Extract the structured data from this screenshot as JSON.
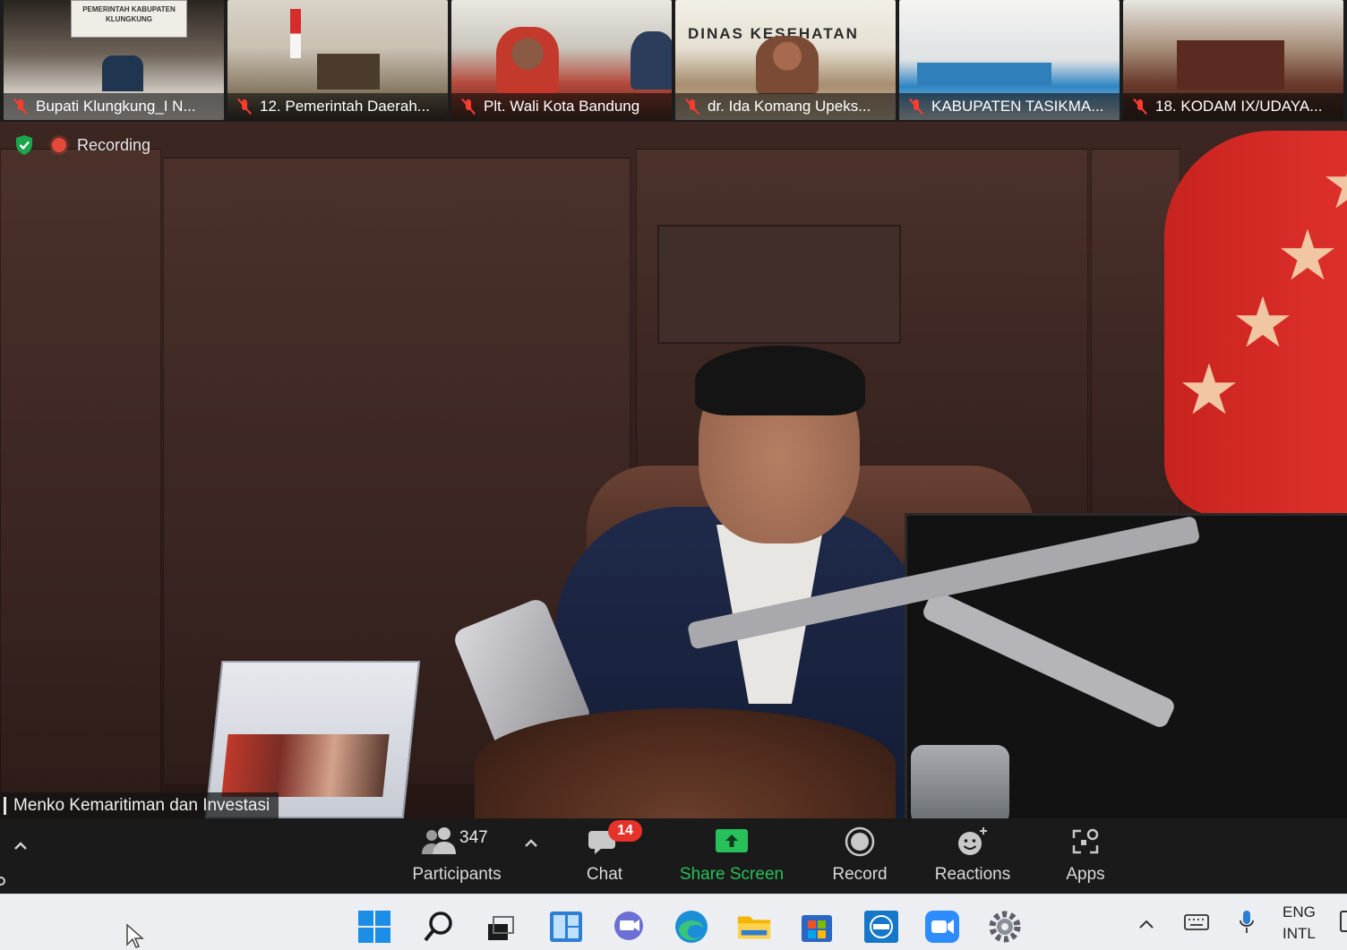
{
  "gallery": {
    "participants": [
      {
        "name": "Bupati Klungkung_I N...",
        "muted": true
      },
      {
        "name": "12. Pemerintah Daerah...",
        "muted": true
      },
      {
        "name": "Plt. Wali Kota Bandung",
        "muted": true
      },
      {
        "name": "dr. Ida Komang Upeks...",
        "muted": true
      },
      {
        "name": "KABUPATEN TASIKMA...",
        "muted": true
      },
      {
        "name": "18. KODAM IX/UDAYA...",
        "muted": true
      }
    ],
    "thumb_signs": {
      "sign_1": "PEMERINTAH KABUPATEN KLUNGKUNG",
      "sign_4": "DINAS KESEHATAN"
    }
  },
  "status": {
    "security_icon": "shield-check-icon",
    "recording_label": "Recording"
  },
  "speaker": {
    "name": "Menko Kemaritiman dan Investasi"
  },
  "toolbar": {
    "participants_label": "Participants",
    "participants_count": "347",
    "chat_label": "Chat",
    "chat_badge": "14",
    "share_label": "Share Screen",
    "record_label": "Record",
    "reactions_label": "Reactions",
    "apps_label": "Apps",
    "share_color": "#27c05a",
    "badge_color": "#e5332a"
  },
  "taskbar": {
    "apps": [
      "start-icon",
      "search-icon",
      "task-view-icon",
      "widgets-icon",
      "teams-chat-icon",
      "edge-icon",
      "file-explorer-icon",
      "store-icon",
      "dell-icon",
      "zoom-icon",
      "settings-icon"
    ],
    "language_line1": "ENG",
    "language_line2": "INTL"
  }
}
